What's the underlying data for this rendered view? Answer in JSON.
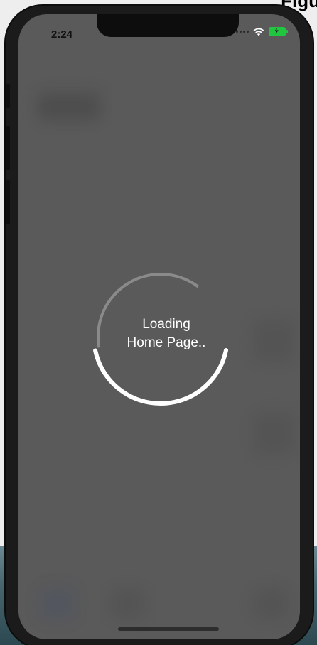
{
  "figure_label": "Figu",
  "status_bar": {
    "time": "2:24",
    "wifi_icon": "wifi-icon",
    "battery_icon": "battery-charging-icon",
    "battery_color": "#20c640"
  },
  "loader": {
    "line1": "Loading",
    "line2": "Home Page..",
    "progress": 0.7,
    "arc_color": "#ffffff",
    "track_color": "#8a8a8a"
  },
  "colors": {
    "overlay": "#5a5a5a",
    "frame": "#1b1b1b"
  }
}
